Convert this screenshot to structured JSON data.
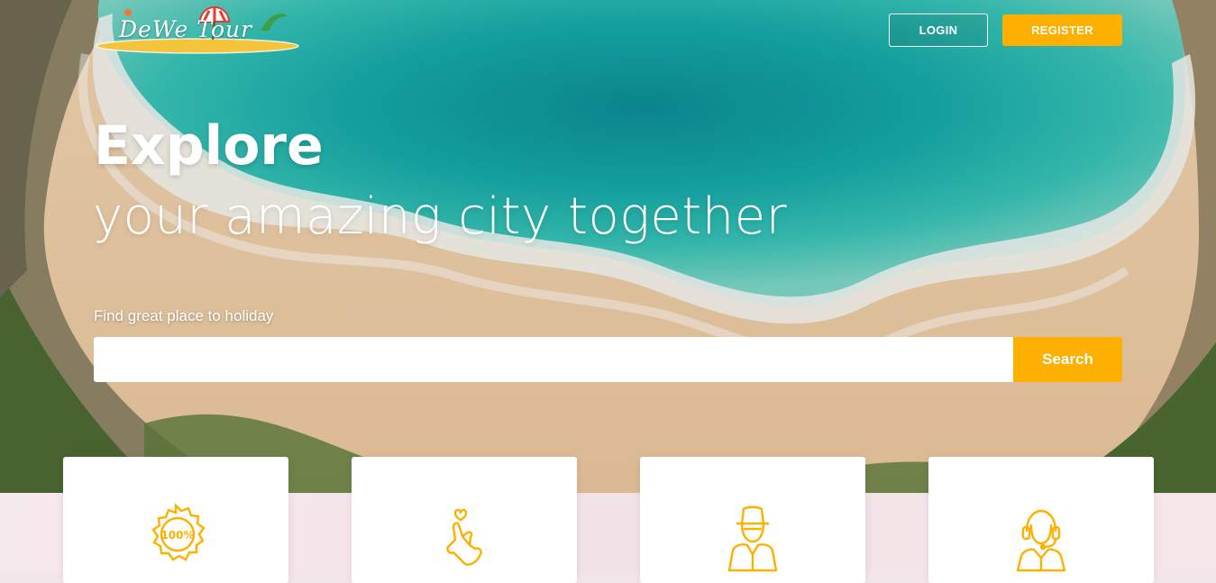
{
  "brand": {
    "logo_text": "DeWe Tour",
    "accent_color": "#fdb000"
  },
  "header": {
    "login_label": "LOGIN",
    "register_label": "REGISTER"
  },
  "hero": {
    "title": "Explore",
    "subtitle": "your amazing city together",
    "search_label": "Find great place to holiday",
    "search_value": "",
    "search_placeholder": "",
    "search_button": "Search"
  },
  "features": {
    "icons": [
      "guarantee-100-percent-icon",
      "heart-hand-icon",
      "agent-hat-icon",
      "support-headset-icon"
    ]
  }
}
